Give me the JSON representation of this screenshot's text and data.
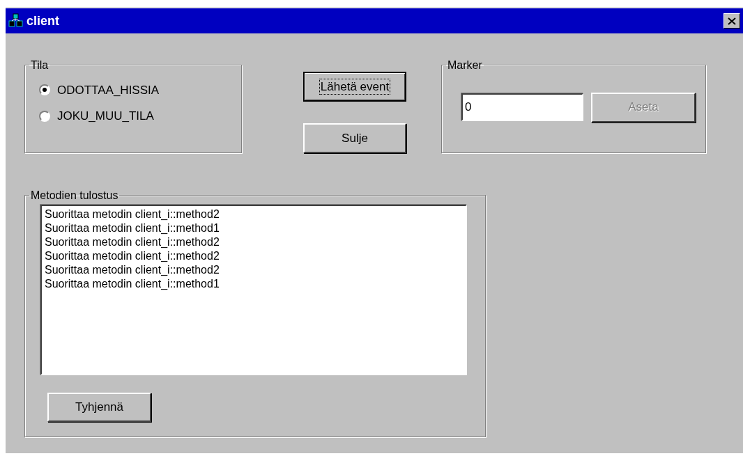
{
  "window": {
    "title": "client"
  },
  "state_group": {
    "label": "Tila",
    "options": [
      {
        "label": "ODOTTAA_HISSIA",
        "selected": true
      },
      {
        "label": "JOKU_MUU_TILA",
        "selected": false
      }
    ]
  },
  "buttons": [
    {
      "label": "Lähetä event",
      "focused": true
    },
    {
      "label": "Sulje",
      "focused": false
    }
  ],
  "marker_group": {
    "label": "Marker",
    "value": "0",
    "button": {
      "label": "Aseta",
      "disabled": true
    }
  },
  "output_group": {
    "label": "Metodien tulostus",
    "lines": [
      "Suorittaa metodin client_i::method2",
      "Suorittaa metodin client_i::method1",
      "Suorittaa metodin client_i::method2",
      "Suorittaa metodin client_i::method2",
      "Suorittaa metodin client_i::method2",
      "Suorittaa metodin client_i::method1"
    ],
    "button": {
      "label": "Tyhjennä",
      "disabled": false
    }
  }
}
